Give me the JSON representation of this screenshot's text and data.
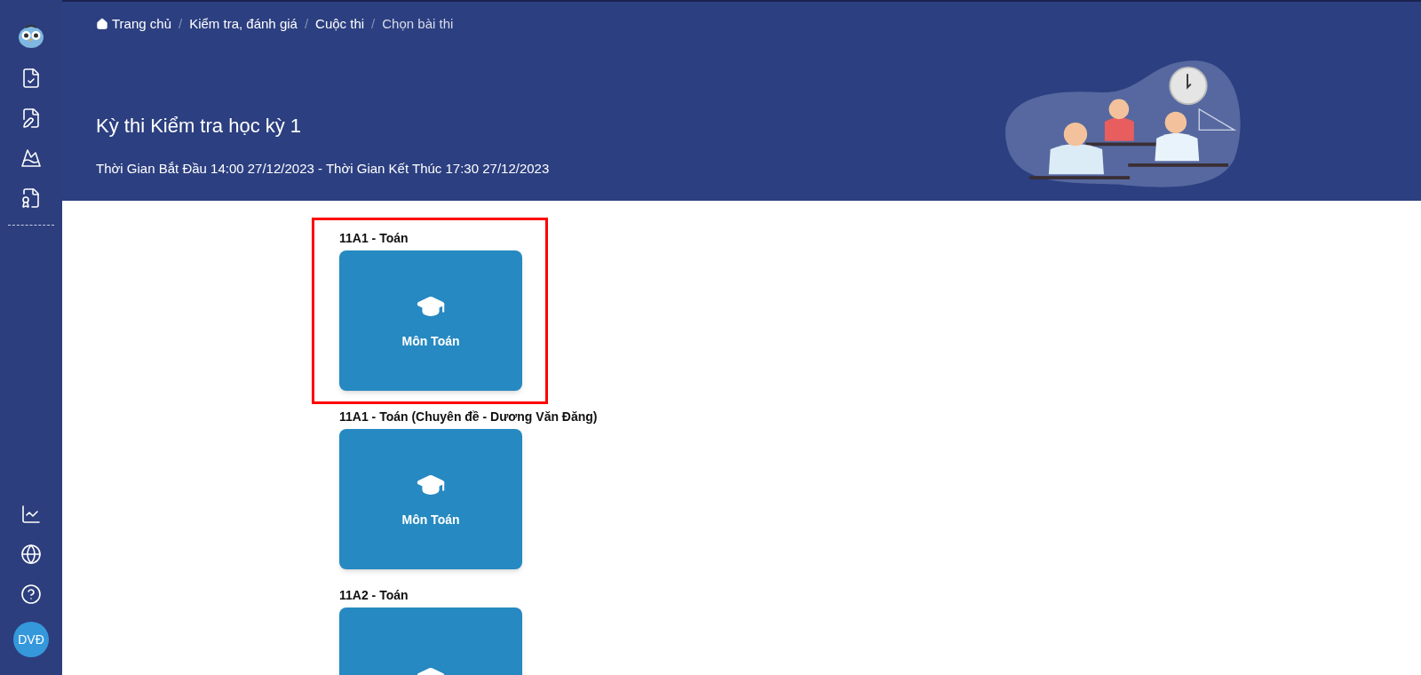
{
  "sidebar": {
    "top_items": [
      {
        "kind": "exam-check"
      },
      {
        "kind": "exam-edit"
      },
      {
        "kind": "goal"
      },
      {
        "kind": "certificate"
      }
    ],
    "bottom_items": [
      {
        "kind": "stats"
      },
      {
        "kind": "globe"
      },
      {
        "kind": "help"
      }
    ],
    "user": {
      "initials": "DVĐ"
    }
  },
  "breadcrumbs": {
    "separator": "/",
    "items": [
      {
        "label": "Trang chủ",
        "current": false
      },
      {
        "label": "Kiểm tra, đánh giá",
        "current": false
      },
      {
        "label": "Cuộc thi",
        "current": false
      },
      {
        "label": "Chọn bài thi",
        "current": true
      }
    ]
  },
  "header": {
    "title": "Kỳ thi Kiểm tra học kỳ 1",
    "schedule": "Thời Gian Bắt Đầu 14:00 27/12/2023 - Thời Gian Kết Thúc 17:30 27/12/2023"
  },
  "exams": [
    {
      "label": "11A1 - Toán",
      "subject": "Môn Toán",
      "highlighted": true
    },
    {
      "label": "11A1 - Toán (Chuyên đề - Dương Văn Đăng)",
      "subject": "Môn Toán",
      "highlighted": false
    },
    {
      "label": "11A2 - Toán",
      "highlighted": false
    }
  ]
}
